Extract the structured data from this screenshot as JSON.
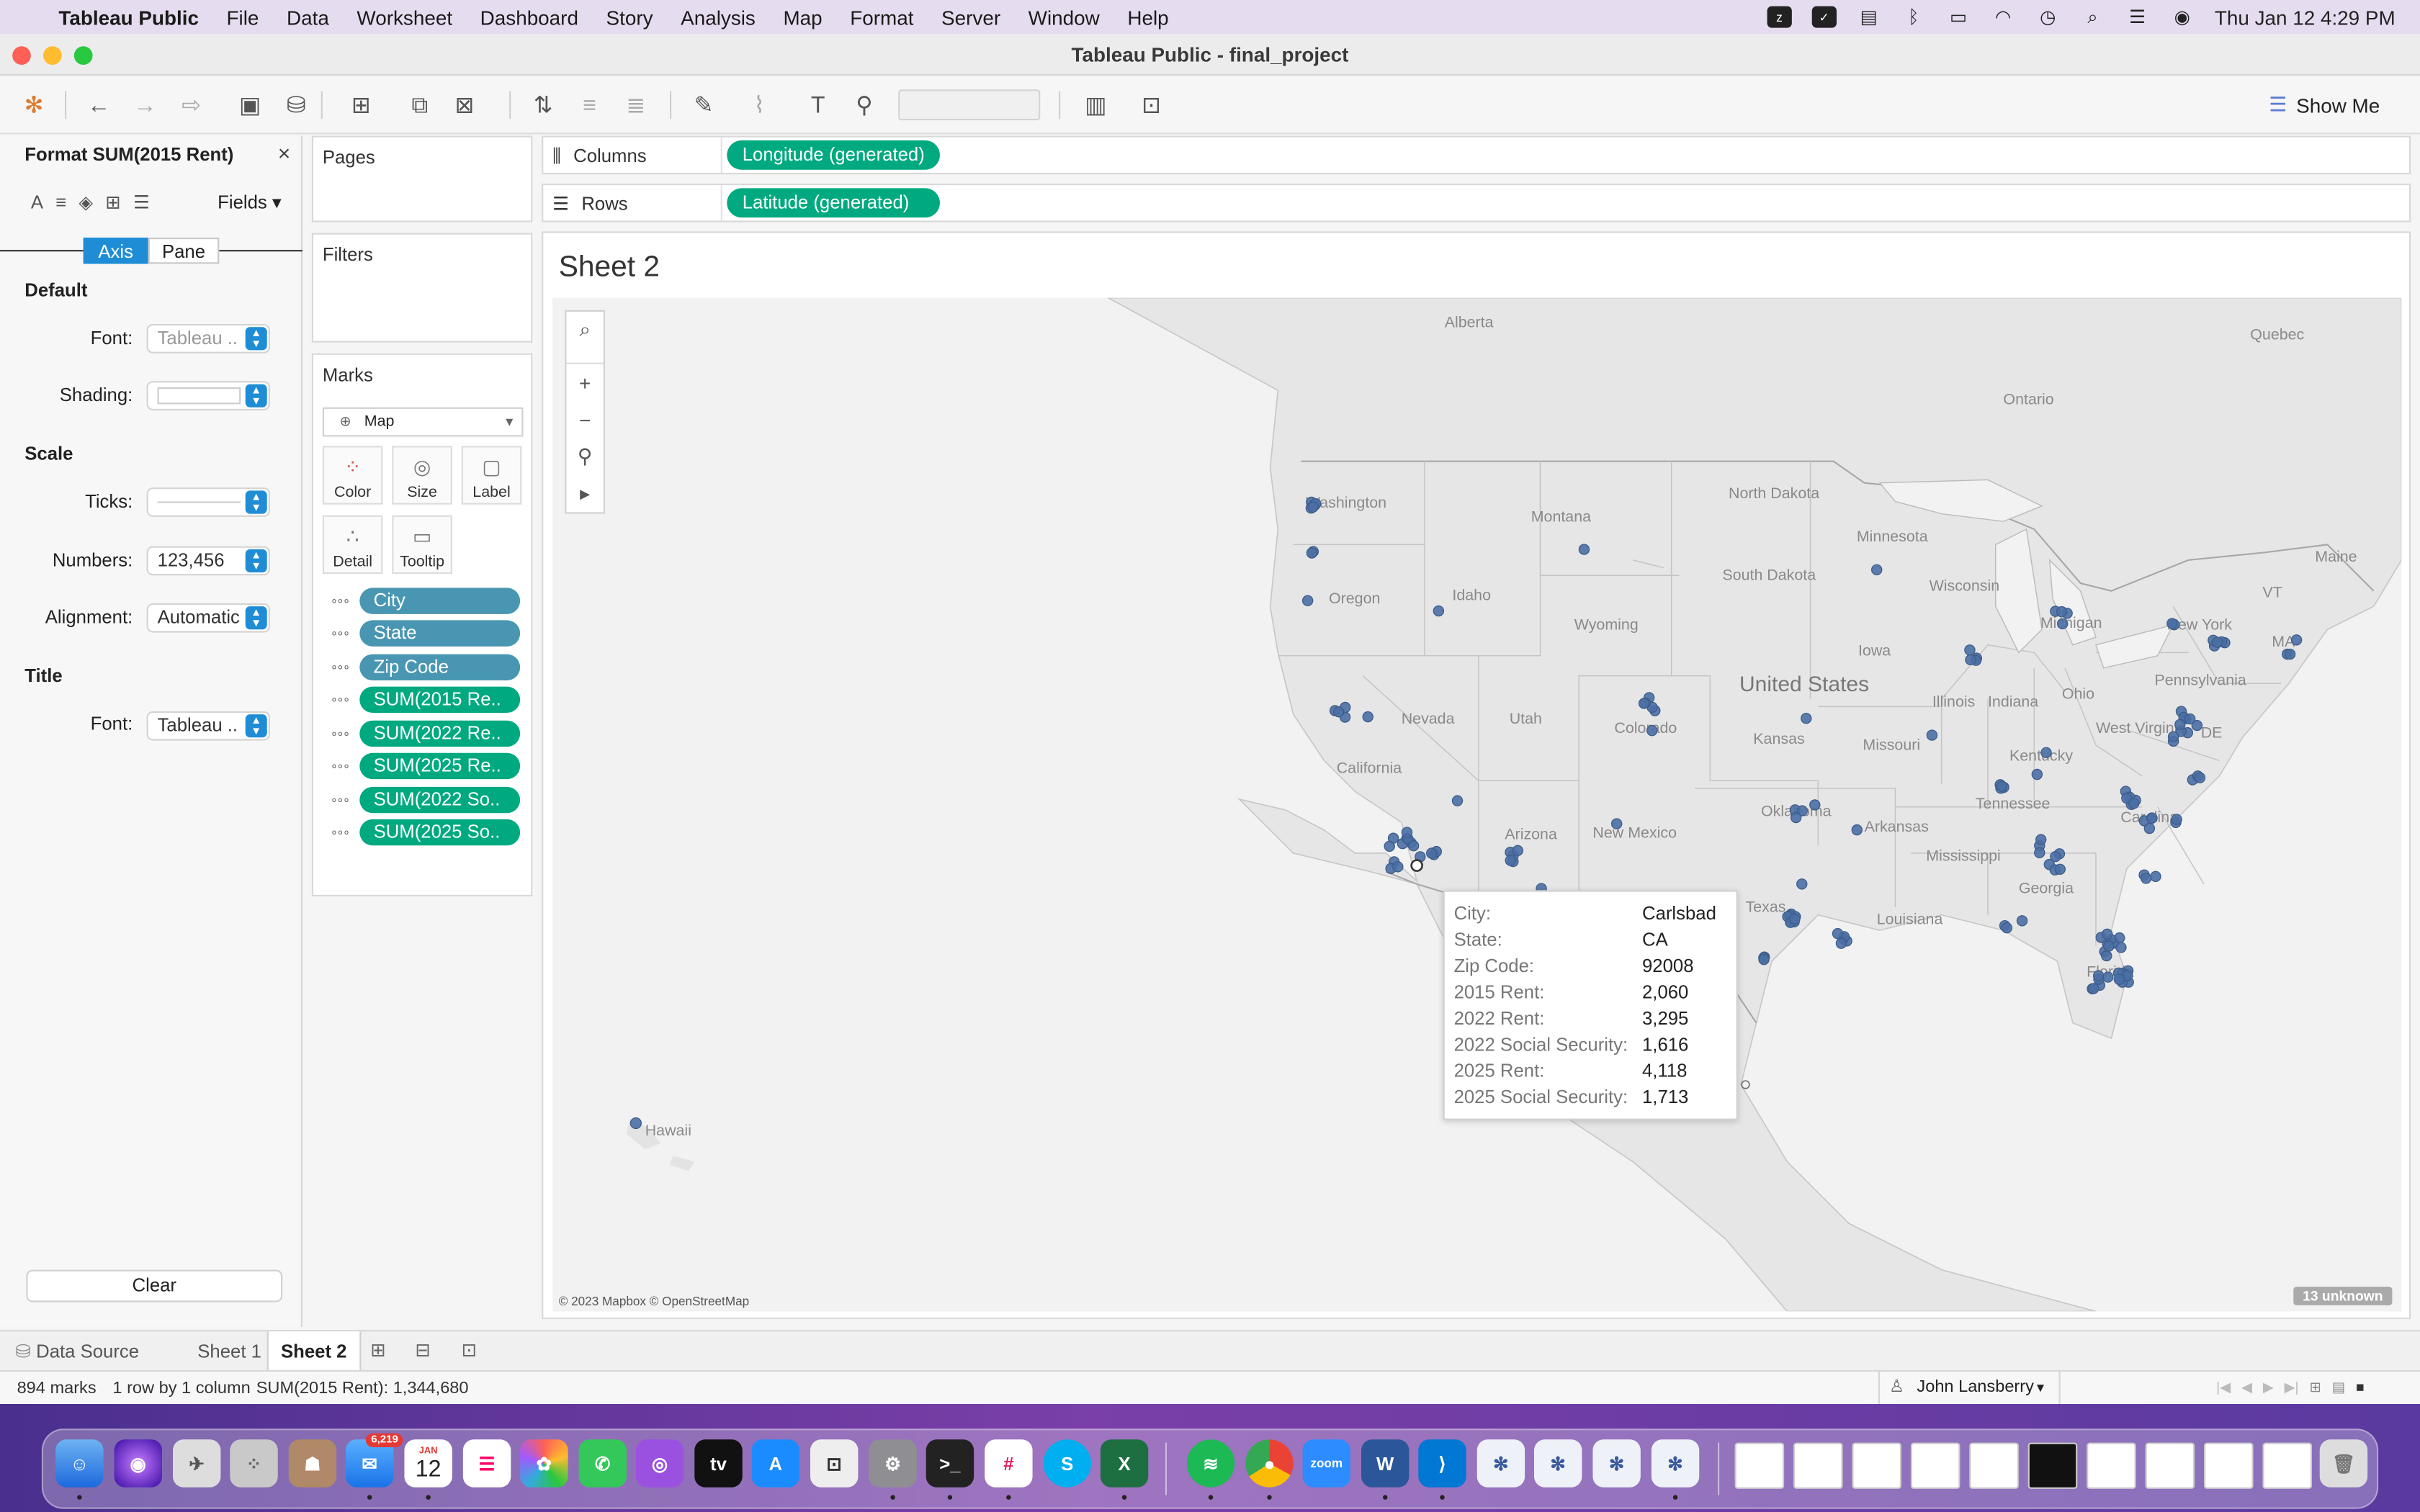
{
  "menubar": {
    "app_name": "Tableau Public",
    "items": [
      "File",
      "Data",
      "Worksheet",
      "Dashboard",
      "Story",
      "Analysis",
      "Map",
      "Format",
      "Server",
      "Window",
      "Help"
    ],
    "clock": "Thu Jan 12  4:29 PM",
    "status_icons": [
      "zoom-icon",
      "reminder-icon",
      "display-icon",
      "bluetooth-icon",
      "battery-icon",
      "wifi-icon",
      "time-machine-icon",
      "spotlight-icon",
      "control-center-icon",
      "siri-icon"
    ]
  },
  "window": {
    "title": "Tableau Public - final_project"
  },
  "toolbar": {
    "show_me_label": "Show Me"
  },
  "format_pane": {
    "title": "Format SUM(2015 Rent)",
    "fields_label": "Fields",
    "tabs": [
      "Axis",
      "Pane"
    ],
    "active_tab": "Axis",
    "sections": {
      "default": "Default",
      "scale": "Scale",
      "title": "Title"
    },
    "rows": {
      "font_label": "Font:",
      "font_value": "Tableau ..",
      "shading_label": "Shading:",
      "ticks_label": "Ticks:",
      "numbers_label": "Numbers:",
      "numbers_value": "123,456",
      "alignment_label": "Alignment:",
      "alignment_value": "Automatic",
      "title_font_label": "Font:",
      "title_font_value": "Tableau .."
    },
    "clear_label": "Clear"
  },
  "cards": {
    "pages": "Pages",
    "filters": "Filters",
    "marks": "Marks",
    "mark_type": "Map",
    "mark_buttons": [
      "Color",
      "Size",
      "Label",
      "Detail",
      "Tooltip"
    ],
    "pills": [
      "City",
      "State",
      "Zip Code",
      "SUM(2015 Re..",
      "SUM(2022 Re..",
      "SUM(2025 Re..",
      "SUM(2022 So..",
      "SUM(2025 So.."
    ]
  },
  "shelves": {
    "columns_label": "Columns",
    "columns_pill": "Longitude (generated)",
    "rows_label": "Rows",
    "rows_pill": "Latitude (generated)"
  },
  "sheet": {
    "title": "Sheet 2",
    "attribution": "© 2023 Mapbox © OpenStreetMap",
    "unknown_badge": "13 unknown",
    "map_labels": [
      "Alberta",
      "Quebec",
      "Ontario",
      "Washington",
      "Montana",
      "North Dakota",
      "Minnesota",
      "Maine",
      "Oregon",
      "Idaho",
      "South Dakota",
      "Wisconsin",
      "Wyoming",
      "Michigan",
      "New York",
      "VT",
      "MA",
      "Iowa",
      "Pennsylvania",
      "Nevada",
      "Utah",
      "Colorado",
      "United States",
      "Illinois",
      "Indiana",
      "Ohio",
      "California",
      "Kansas",
      "Missouri",
      "West Virginia",
      "Kentucky",
      "DE",
      "Tennessee",
      "Arizona",
      "New Mexico",
      "Oklahoma",
      "Arkansas",
      "Mississippi",
      "Texas",
      "Louisiana",
      "Georgia",
      "Florida",
      "Hawaii",
      "Carolina"
    ]
  },
  "tooltip": {
    "rows": [
      {
        "k": "City:",
        "v": "Carlsbad"
      },
      {
        "k": "State:",
        "v": "CA"
      },
      {
        "k": "Zip Code:",
        "v": "92008"
      },
      {
        "k": "2015 Rent:",
        "v": "2,060"
      },
      {
        "k": "2022 Rent:",
        "v": "3,295"
      },
      {
        "k": "2022 Social Security:",
        "v": "1,616"
      },
      {
        "k": "2025 Rent:",
        "v": "4,118"
      },
      {
        "k": "2025 Social Security:",
        "v": "1,713"
      }
    ]
  },
  "tabs": {
    "data_source": "Data Source",
    "sheets": [
      "Sheet 1",
      "Sheet 2"
    ],
    "active": "Sheet 2"
  },
  "statusbar": {
    "marks": "894 marks",
    "dims": "1 row by 1 column",
    "sum": "SUM(2015 Rent): 1,344,680",
    "user": "John Lansberry"
  },
  "dock": {
    "mail_badge": "6,219",
    "calendar_month": "JAN",
    "calendar_day": "12"
  },
  "colors": {
    "dimension_pill": "#4996b2",
    "measure_pill": "#00a97f",
    "accent": "#1f8dd6",
    "map_mark": "#4a6fa5"
  }
}
